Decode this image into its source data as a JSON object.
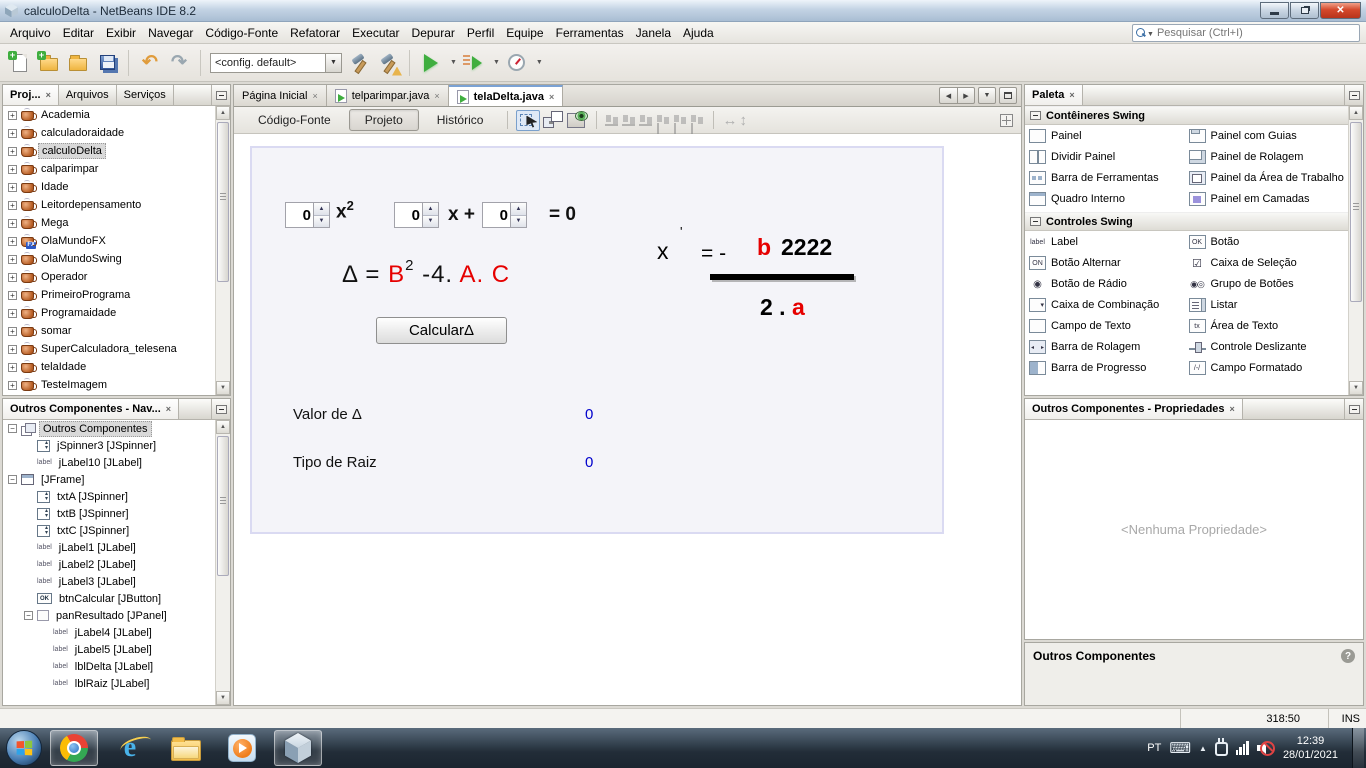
{
  "window": {
    "title": "calculoDelta - NetBeans IDE 8.2"
  },
  "menu": {
    "items": [
      "Arquivo",
      "Editar",
      "Exibir",
      "Navegar",
      "Código-Fonte",
      "Refatorar",
      "Executar",
      "Depurar",
      "Perfil",
      "Equipe",
      "Ferramentas",
      "Janela",
      "Ajuda"
    ]
  },
  "search": {
    "placeholder": "Pesquisar (Ctrl+I)"
  },
  "toolbar": {
    "config_value": "<config. default>"
  },
  "projects": {
    "tabs": [
      "Proj...",
      "Arquivos",
      "Serviços"
    ],
    "items": [
      {
        "label": "Academia"
      },
      {
        "label": "calculadoraidade"
      },
      {
        "label": "calculoDelta",
        "selected": true
      },
      {
        "label": "calparimpar"
      },
      {
        "label": "Idade"
      },
      {
        "label": "Leitordepensamento"
      },
      {
        "label": "Mega"
      },
      {
        "label": "OlaMundoFX",
        "fx": true
      },
      {
        "label": "OlaMundoSwing"
      },
      {
        "label": "Operador"
      },
      {
        "label": "PrimeiroPrograma"
      },
      {
        "label": "Programaidade"
      },
      {
        "label": "somar"
      },
      {
        "label": "SuperCalculadora_telesena"
      },
      {
        "label": "telaIdade"
      },
      {
        "label": "TesteImagem"
      }
    ]
  },
  "navigator": {
    "title": "Outros Componentes - Nav...",
    "nodes": [
      {
        "label": "Outros Componentes",
        "icon": "form",
        "level": 0,
        "expand": true,
        "selected": true
      },
      {
        "label": "jSpinner3 [JSpinner]",
        "icon": "spin",
        "level": 1
      },
      {
        "label": "jLabel10 [JLabel]",
        "icon": "label",
        "level": 1
      },
      {
        "label": "[JFrame]",
        "icon": "frame",
        "level": 0,
        "expand": true
      },
      {
        "label": "txtA [JSpinner]",
        "icon": "spin",
        "level": 1
      },
      {
        "label": "txtB [JSpinner]",
        "icon": "spin",
        "level": 1
      },
      {
        "label": "txtC [JSpinner]",
        "icon": "spin",
        "level": 1
      },
      {
        "label": "jLabel1 [JLabel]",
        "icon": "label",
        "level": 1
      },
      {
        "label": "jLabel2 [JLabel]",
        "icon": "label",
        "level": 1
      },
      {
        "label": "jLabel3 [JLabel]",
        "icon": "label",
        "level": 1
      },
      {
        "label": "btnCalcular [JButton]",
        "icon": "ok",
        "level": 1
      },
      {
        "label": "panResultado [JPanel]",
        "icon": "panel",
        "level": 1,
        "expand": true
      },
      {
        "label": "jLabel4 [JLabel]",
        "icon": "label",
        "level": 2
      },
      {
        "label": "jLabel5 [JLabel]",
        "icon": "label",
        "level": 2
      },
      {
        "label": "lblDelta [JLabel]",
        "icon": "label",
        "level": 2
      },
      {
        "label": "lblRaiz [JLabel]",
        "icon": "label",
        "level": 2
      }
    ]
  },
  "editor": {
    "tabs": [
      {
        "label": "Página Inicial",
        "java_icon": false,
        "active": false
      },
      {
        "label": "telparimpar.java",
        "java_icon": true,
        "active": false
      },
      {
        "label": "telaDelta.java",
        "java_icon": true,
        "active": true
      }
    ],
    "views": [
      "Código-Fonte",
      "Projeto",
      "Histórico"
    ]
  },
  "form": {
    "spin_a": "0",
    "term_a_base": "x",
    "term_a_exp": "2",
    "spin_b": "0",
    "term_b": "x +",
    "spin_c": "0",
    "term_c": "= 0",
    "delta_prefix": "Δ = ",
    "delta_b": "B",
    "delta_exp": "2",
    "delta_mid": " -4.",
    "delta_ac": " A. C",
    "calc_button": "CalcularΔ",
    "root_x": "x",
    "root_prime": "'",
    "root_eq": "= -",
    "root_b": "b",
    "root_num": "2222",
    "root_den_left": "2 .",
    "root_den_right": "a",
    "delta_value_label": "Valor de Δ",
    "delta_value": "0",
    "root_type_label": "Tipo de Raiz",
    "root_type_value": "0"
  },
  "palette": {
    "title": "Paleta",
    "sections": [
      {
        "title": "Contêineres Swing",
        "items": [
          {
            "label": "Painel",
            "icon": "panel"
          },
          {
            "label": "Painel com Guias",
            "icon": "tabbed-pane"
          },
          {
            "label": "Dividir Painel",
            "icon": "split-pane"
          },
          {
            "label": "Painel de Rolagem",
            "icon": "scroll-pane"
          },
          {
            "label": "Barra de Ferramentas",
            "icon": "toolbar"
          },
          {
            "label": "Painel da Área de Trabalho",
            "icon": "desktop-pane"
          },
          {
            "label": "Quadro Interno",
            "icon": "internal-frame"
          },
          {
            "label": "Painel em Camadas",
            "icon": "layered-pane"
          }
        ]
      },
      {
        "title": "Controles Swing",
        "items": [
          {
            "label": "Label",
            "icon": "label"
          },
          {
            "label": "Botão",
            "icon": "button"
          },
          {
            "label": "Botão Alternar",
            "icon": "toggle-button"
          },
          {
            "label": "Caixa de Seleção",
            "icon": "checkbox"
          },
          {
            "label": "Botão de Rádio",
            "icon": "radio-button"
          },
          {
            "label": "Grupo de Botões",
            "icon": "button-group"
          },
          {
            "label": "Caixa de Combinação",
            "icon": "combo-box"
          },
          {
            "label": "Listar",
            "icon": "list"
          },
          {
            "label": "Campo de Texto",
            "icon": "text-field"
          },
          {
            "label": "Área de Texto",
            "icon": "text-area"
          },
          {
            "label": "Barra de Rolagem",
            "icon": "scrollbar"
          },
          {
            "label": "Controle Deslizante",
            "icon": "slider"
          },
          {
            "label": "Barra de Progresso",
            "icon": "progress-bar"
          },
          {
            "label": "Campo Formatado",
            "icon": "formatted-field"
          }
        ]
      }
    ]
  },
  "properties": {
    "title": "Outros Componentes - Propriedades",
    "empty_text": "<Nenhuma Propriedade>",
    "footer_title": "Outros Componentes"
  },
  "statusbar": {
    "position": "318:50",
    "insert_mode": "INS"
  },
  "taskbar": {
    "language": "PT",
    "time": "12:39",
    "date": "28/01/2021"
  }
}
